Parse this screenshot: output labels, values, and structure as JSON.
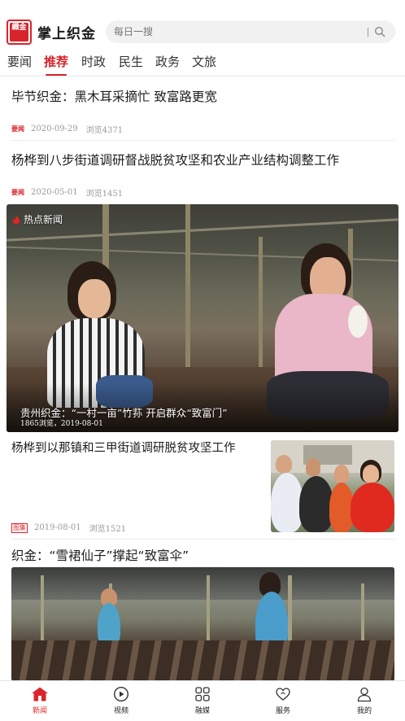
{
  "header": {
    "logo_text": "織金",
    "app_title": "掌上织金",
    "search_placeholder": "每日一搜"
  },
  "tabs": [
    {
      "label": "要闻",
      "active": false
    },
    {
      "label": "推荐",
      "active": true
    },
    {
      "label": "时政",
      "active": false
    },
    {
      "label": "民生",
      "active": false
    },
    {
      "label": "政务",
      "active": false
    },
    {
      "label": "文旅",
      "active": false
    }
  ],
  "articles": [
    {
      "title": "毕节织金：黑木耳采摘忙  致富路更宽",
      "tag": "要闻",
      "date": "2020-09-29",
      "views": "浏览4371"
    },
    {
      "title": "杨桦到八步街道调研督战脱贫攻坚和农业产业结构调整工作",
      "tag": "要闻",
      "date": "2020-05-01",
      "views": "浏览1451"
    }
  ],
  "featured": {
    "badge": "热点新闻",
    "title": "贵州织金：“一村一亩”竹荪 开启群众“致富门”",
    "views": "1865浏览",
    "date": "2019-08-01"
  },
  "article_with_image": {
    "title": "杨桦到以那镇和三甲街道调研脱贫攻坚工作",
    "tag": "图集",
    "date": "2019-08-01",
    "views": "浏览1521"
  },
  "last_article": {
    "title": "织金：“雪裙仙子”撑起“致富伞”"
  },
  "colors": {
    "accent": "#d8252b"
  },
  "bottom_nav": [
    {
      "label": "新闻",
      "icon": "home-icon",
      "active": true
    },
    {
      "label": "视频",
      "icon": "play-icon",
      "active": false
    },
    {
      "label": "融媒",
      "icon": "grid-icon",
      "active": false
    },
    {
      "label": "服务",
      "icon": "heart-icon",
      "active": false
    },
    {
      "label": "我的",
      "icon": "user-icon",
      "active": false
    }
  ]
}
